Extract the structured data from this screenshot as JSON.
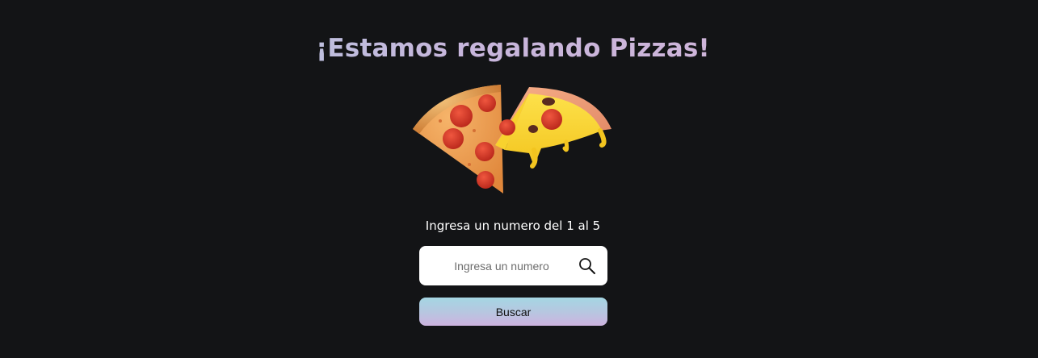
{
  "header": {
    "title": "¡Estamos regalando Pizzas!"
  },
  "hero": {
    "image": "two-pizza-slices-illustration"
  },
  "form": {
    "prompt": "Ingresa un numero del 1 al 5",
    "input_placeholder": "Ingresa un numero",
    "input_value": "",
    "search_icon": "magnifier-icon",
    "button_label": "Buscar"
  },
  "colors": {
    "background": "#131416",
    "title_gradient_start": "#a9cfe0",
    "title_gradient_end": "#d7b3d6",
    "button_gradient_start": "#a4d6e3",
    "button_gradient_end": "#cdb3df"
  }
}
